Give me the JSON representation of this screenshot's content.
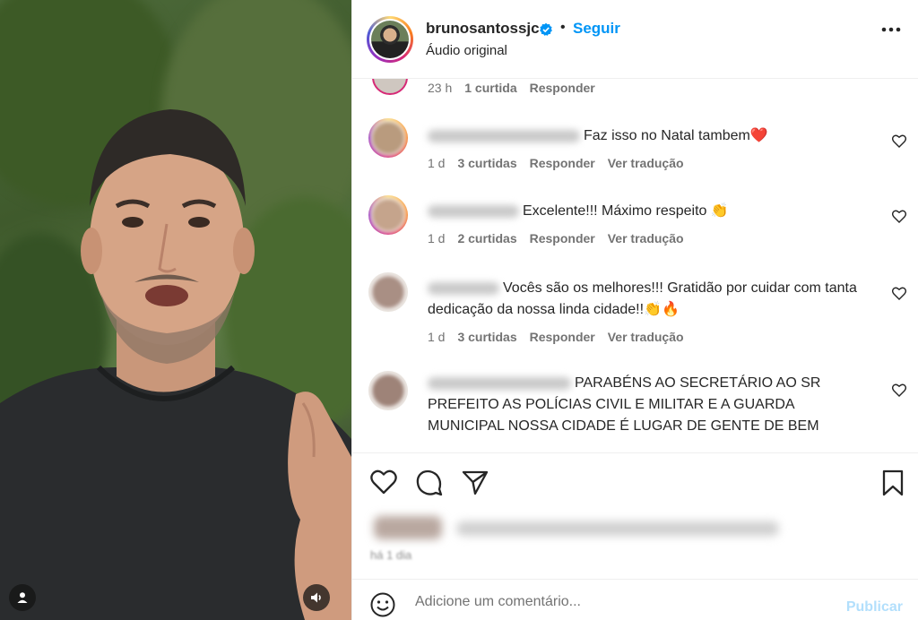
{
  "post": {
    "username": "brunosantossjc",
    "separator": "•",
    "follow_label": "Seguir",
    "audio_label": "Áudio original"
  },
  "top_comment_meta": {
    "time": "23 h",
    "likes": "1 curtida",
    "reply": "Responder"
  },
  "comments": [
    {
      "text": "Faz isso no Natal tambem",
      "emoji": "❤️",
      "time": "1 d",
      "likes": "3 curtidas",
      "reply": "Responder",
      "translate": "Ver tradução"
    },
    {
      "text": "Excelente!!! Máximo respeito",
      "emoji": "👏",
      "time": "1 d",
      "likes": "2 curtidas",
      "reply": "Responder",
      "translate": "Ver tradução"
    },
    {
      "text": "Vocês são os melhores!!! Gratidão por cuidar com tanta dedicação da nossa linda cidade!!",
      "emoji": "👏🔥",
      "time": "1 d",
      "likes": "3 curtidas",
      "reply": "Responder",
      "translate": "Ver tradução"
    },
    {
      "text": "PARABÉNS AO SECRETÁRIO AO SR PREFEITO AS POLÍCIAS CIVIL E MILITAR E A GUARDA MUNICIPAL NOSSA CIDADE É LUGAR DE GENTE DE BEM"
    }
  ],
  "timestamp": "há 1 dia",
  "comment_input": {
    "placeholder": "Adicione um comentário...",
    "post_label": "Publicar"
  },
  "colors": {
    "accent": "#0095f6",
    "post_disabled": "#b2dffc",
    "heart_red": "#ed4956"
  },
  "icons": [
    "verified-icon",
    "more-icon",
    "heart-icon",
    "comment-icon",
    "share-icon",
    "bookmark-icon",
    "emoji-icon",
    "user-icon",
    "speaker-icon"
  ]
}
